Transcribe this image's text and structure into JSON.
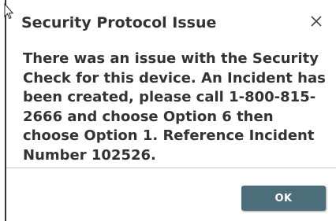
{
  "dialog": {
    "title": "Security Protocol Issue",
    "close_icon": "close-icon",
    "message": "There was an issue with the Security Check for this device. An Incident has been created, please call 1-800-815-2666 and choose Option 6 then choose Option 1. Reference Incident Number 102526.",
    "ok_label": "OK"
  },
  "colors": {
    "text": "#333333",
    "button_bg": "#4c6e7a",
    "button_text": "#ffffff",
    "divider": "#c8c8c8"
  },
  "cursor_icon": "mouse-pointer-icon"
}
